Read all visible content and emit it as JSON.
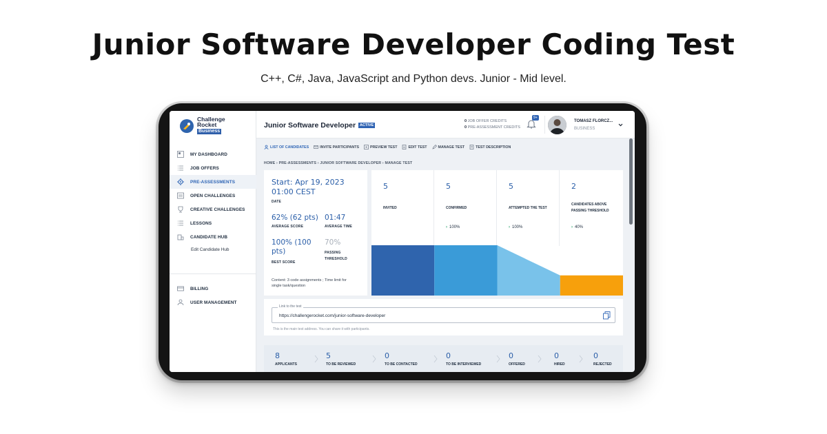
{
  "hero": {
    "title": "Junior Software Developer Coding Test",
    "subtitle": "C++, C#, Java, JavaScript and Python devs. Junior - Mid level."
  },
  "app": {
    "logo": {
      "line1": "Challenge",
      "line2": "Rocket",
      "badge": "Business"
    },
    "sidebar": {
      "items": [
        {
          "label": "MY DASHBOARD",
          "icon": "dashboard-icon"
        },
        {
          "label": "JOB OFFERS",
          "icon": "list-icon"
        },
        {
          "label": "PRE-ASSESSMENTS",
          "icon": "gear-icon",
          "active": true
        },
        {
          "label": "OPEN CHALLENGES",
          "icon": "list-icon"
        },
        {
          "label": "CREATIVE CHALLENGES",
          "icon": "trophy-icon"
        },
        {
          "label": "LESSONS",
          "icon": "list-icon"
        },
        {
          "label": "CANDIDATE HUB",
          "icon": "building-icon"
        }
      ],
      "sub_item": "Edit Candidate Hub",
      "bottom": [
        {
          "label": "BILLING",
          "icon": "card-icon"
        },
        {
          "label": "USER MANAGEMENT",
          "icon": "user-icon"
        }
      ]
    },
    "header": {
      "title": "Junior Software Developer",
      "status": "ACTIVE",
      "job_credits_count": "0",
      "job_credits_label": "JOB OFFER CREDITS",
      "pre_credits_count": "0",
      "pre_credits_label": "PRE-ASSESSMENT CREDITS",
      "notifications": "9+",
      "user_name": "TOMASZ FLORCZ...",
      "user_role": "BUSINESS"
    },
    "tabs": [
      "LIST OF CANDIDATES",
      "INVITE PARTICIPANTS",
      "PREVIEW TEST",
      "EDIT TEST",
      "MANAGE TEST",
      "TEST DESCRIPTION"
    ],
    "breadcrumb": "HOME  ›  PRE-ASSESSMENTS  ›  JUNIOR SOFTWARE DEVELOPER  ›  MANAGE TEST",
    "summary": {
      "start_line1": "Start: Apr 19, 2023",
      "start_line2": "01:00 CEST",
      "date_label": "DATE",
      "avg_score": "62% (62 pts)",
      "avg_score_label": "AVERAGE SCORE",
      "avg_time": "01:47",
      "avg_time_label": "AVERAGE TIME",
      "best_score_line1": "100% (100",
      "best_score_line2": "pts)",
      "best_score_label": "BEST SCORE",
      "threshold": "70%",
      "threshold_label_line1": "PASSING",
      "threshold_label_line2": "THRESHOLD",
      "content_line1": "Content: 3 code assignments ; Time limit for",
      "content_line2": "single task/question"
    },
    "funnel": {
      "stages": [
        {
          "count": "5",
          "label": "INVITED",
          "pct": "",
          "color": "#2f64ad",
          "level": 1.0
        },
        {
          "count": "5",
          "label": "CONFIRMED",
          "pct": "100%",
          "color": "#3a9bd8",
          "level": 1.0
        },
        {
          "count": "5",
          "label": "ATTEMPTED THE TEST",
          "pct": "100%",
          "color": "#79c2ea",
          "level": 1.0
        },
        {
          "count": "2",
          "label_line1": "CANDIDATES ABOVE",
          "label_line2": "PASSING THRESHOLD",
          "pct": "40%",
          "color": "#f7a00c",
          "level": 0.4
        }
      ]
    },
    "link": {
      "legend": "Link to the test",
      "value": "https://challengerocket.com/junior-software-developer",
      "help": "This is the main test address. You can share it with participants."
    },
    "pipeline": [
      {
        "count": "8",
        "label": "APPLICANTS"
      },
      {
        "count": "5",
        "label": "TO BE REVIEWED"
      },
      {
        "count": "0",
        "label": "TO BE CONTACTED"
      },
      {
        "count": "0",
        "label": "TO BE INTERVIEWED"
      },
      {
        "count": "0",
        "label": "OFFERED"
      },
      {
        "count": "0",
        "label": "HIRED"
      },
      {
        "count": "0",
        "label": "REJECTED"
      }
    ]
  }
}
